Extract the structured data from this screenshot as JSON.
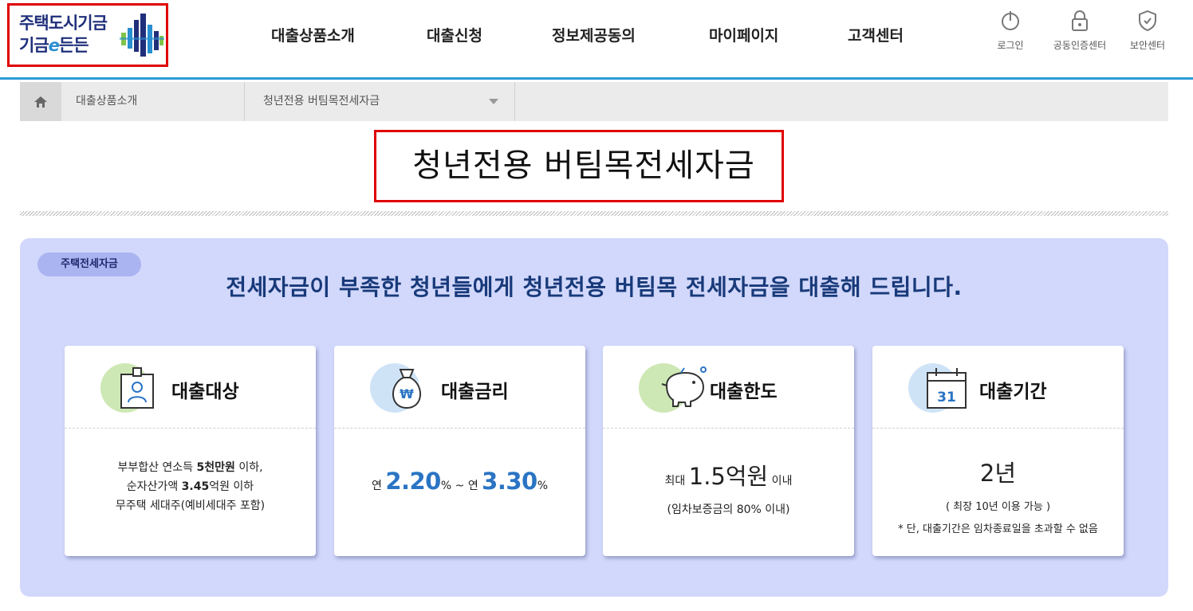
{
  "header": {
    "logo": {
      "line1": "주택도시기금",
      "line2a": "기금",
      "line2b": "e",
      "line2c": "든든"
    },
    "gnb": [
      "대출상품소개",
      "대출신청",
      "정보제공동의",
      "마이페이지",
      "고객센터"
    ],
    "util": [
      {
        "label": "로그인",
        "icon": "power-icon"
      },
      {
        "label": "공동인증센터",
        "icon": "lock-icon"
      },
      {
        "label": "보안센터",
        "icon": "shield-icon"
      }
    ],
    "accent_color": "#2a9bd4"
  },
  "breadcrumb": {
    "level1": "대출상품소개",
    "level2": "청년전용 버팀목전세자금"
  },
  "page_title": "청년전용 버팀목전세자금",
  "panel": {
    "badge": "주택전세자금",
    "headline": "전세자금이 부족한 청년들에게 청년전용 버팀목 전세자금을 대출해 드립니다.",
    "bg_color": "#d2d8fb"
  },
  "cards": [
    {
      "title": "대출대상",
      "icon": "id-card-icon",
      "lines": [
        {
          "a": "부부합산 연소득 ",
          "b": "5천만원",
          "c": " 이하,"
        },
        {
          "a": "순자산가액 ",
          "b": "3.45",
          "c": "억원 이하"
        },
        {
          "a": "무주택 세대주(예비세대주 포함)"
        }
      ]
    },
    {
      "title": "대출금리",
      "icon": "money-bag-icon",
      "prefix1": "연 ",
      "rate1": "2.20",
      "unit1": "%",
      "sep": " ~ 연 ",
      "rate2": "3.30",
      "unit2": "%"
    },
    {
      "title": "대출한도",
      "icon": "piggy-bank-icon",
      "prefix": "최대 ",
      "amount": "1.5억원",
      "suffix": " 이내",
      "note": "(임차보증금의 80% 이내)"
    },
    {
      "title": "대출기간",
      "icon": "calendar-icon",
      "calendar_day": "31",
      "period": "2년",
      "note1": "( 최장 10년 이용 가능 )",
      "note2": "* 단, 대출기간은 임차종료일을 초과할 수 없음"
    }
  ]
}
